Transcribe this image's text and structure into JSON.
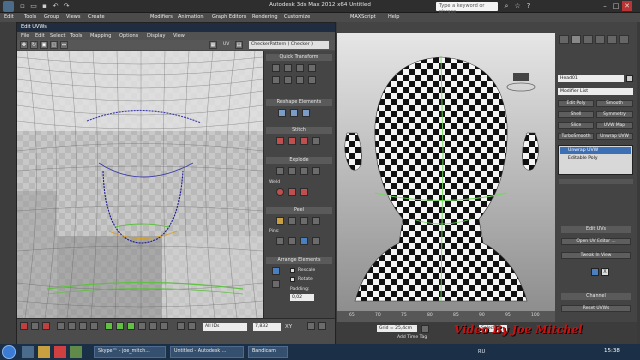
{
  "app": {
    "title": "Autodesk 3ds Max  2012 x64     Untitled",
    "search_placeholder": "Type a keyword or phrase"
  },
  "menubar": [
    "Edit",
    "Tools",
    "Group",
    "Views",
    "Create",
    "Modifiers",
    "Animation",
    "Graph Editors",
    "Rendering",
    "Customize",
    "MAXScript",
    "Help"
  ],
  "uvw_editor": {
    "title": "Edit UVWs",
    "menu": [
      "File",
      "Edit",
      "Select",
      "Tools",
      "Mapping",
      "Options",
      "Display",
      "View"
    ],
    "uv_label": "UV",
    "checker_value": "CheckerPattern  ( Checker )",
    "side_sections": {
      "quick_transform": "Quick Transform",
      "reshape": "Reshape Elements",
      "stitch": "Stitch",
      "explode": "Explode",
      "weld": "Weld",
      "peel": "Peel",
      "pins": "Pins:",
      "arrange": "Arrange Elements",
      "rescale": "Rescale",
      "rotate": "Rotate",
      "padding_label": "Padding:",
      "padding_value": "0,02"
    },
    "bottom": {
      "ids_value": "All IDs",
      "u_value": "7,832",
      "xy_label": "XY"
    }
  },
  "viewport": {
    "timeline_ticks": [
      "65",
      "70",
      "75",
      "80",
      "85",
      "90",
      "95",
      "100"
    ]
  },
  "command_panel": {
    "object_name": "Head01",
    "modifier_list": "Modifier List",
    "buttons": [
      [
        "Edit Poly",
        "Smooth"
      ],
      [
        "Shell",
        "Symmetry"
      ],
      [
        "Slice",
        "UVW Map"
      ],
      [
        "TurboSmooth",
        "Unwrap UVW"
      ]
    ],
    "stack": [
      "Unwrap UVW",
      "Editable Poly"
    ],
    "edit_uvs_label": "Edit UVs",
    "open_editor": "Open UV Editor ...",
    "tweak": "Tweak In View",
    "channel_label": "Channel",
    "reset": "Reset UVWs"
  },
  "status": {
    "grid": "Grid = 25,4cm",
    "add_time_tag": "Add Time Tag",
    "selected": "Selected"
  },
  "watermark": "Video By Joe Mitchel",
  "taskbar": {
    "tasks": [
      "Skype™ - joe_mitch...",
      "Untitled - Autodesk ...",
      "Bandicam"
    ],
    "lang": "RU",
    "time": "15:38"
  }
}
